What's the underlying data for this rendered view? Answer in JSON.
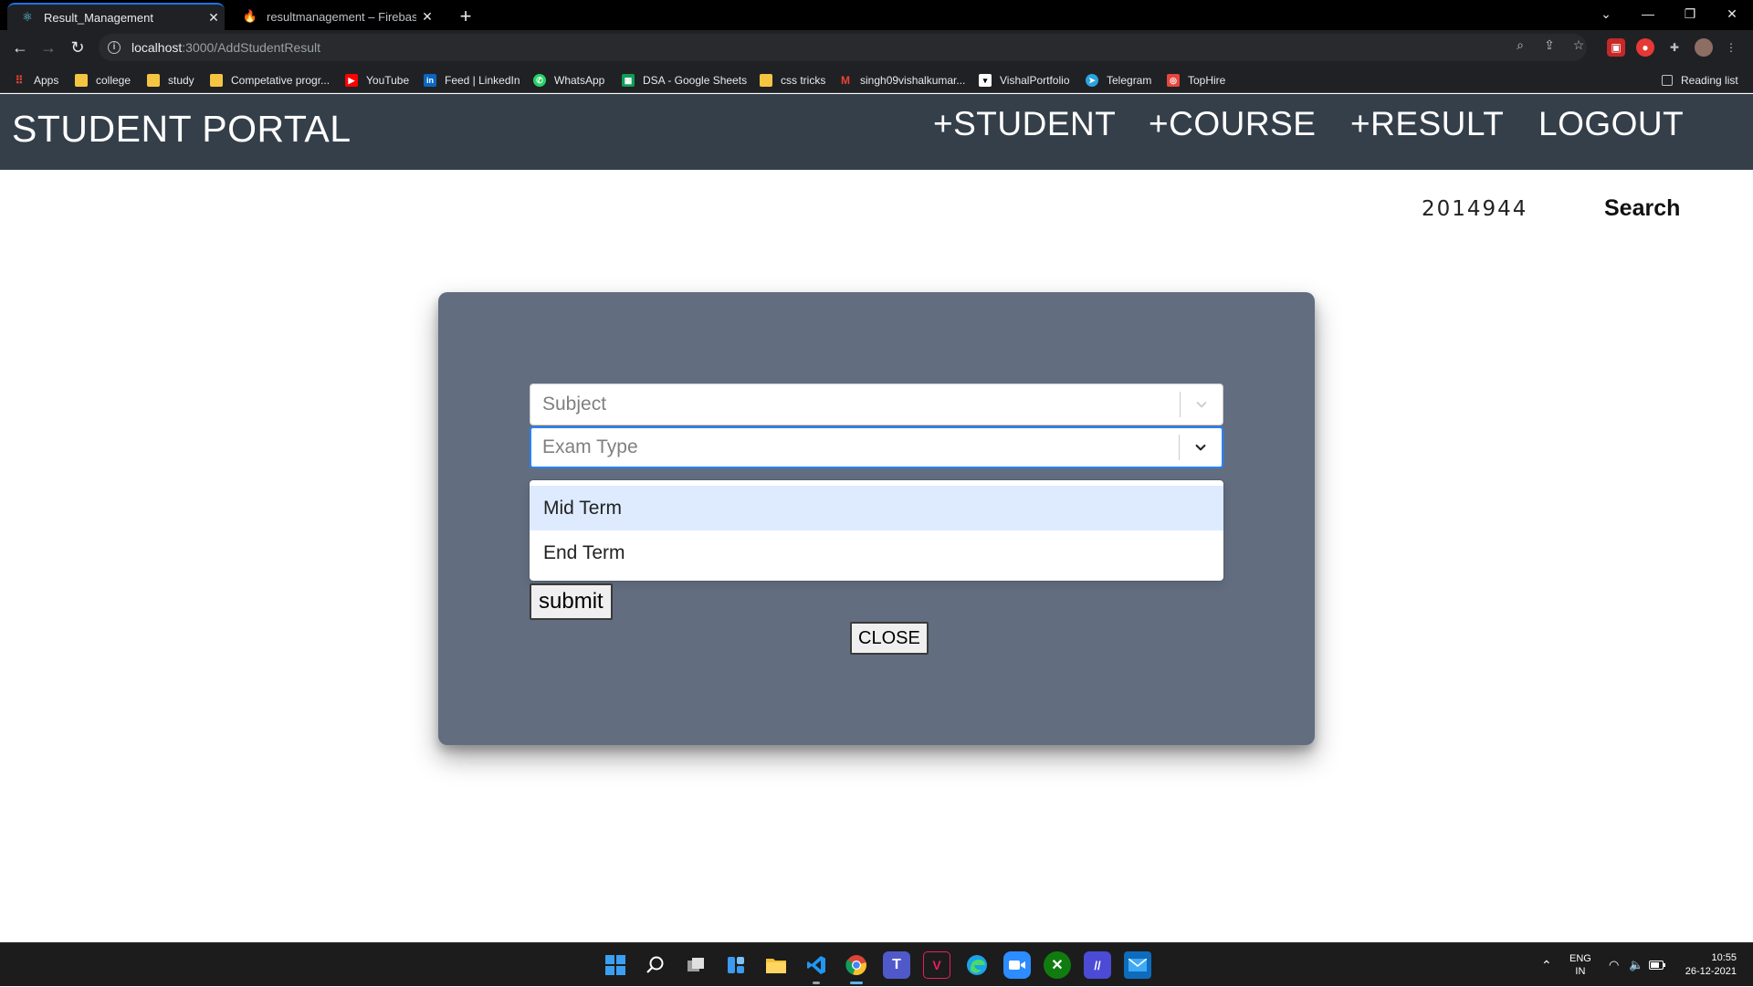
{
  "browser": {
    "tabs": [
      {
        "title": "Result_Management",
        "favicon": "react-icon",
        "active": true
      },
      {
        "title": "resultmanagement – Firebase co",
        "favicon": "firebase-icon",
        "active": false
      }
    ],
    "url_host": "localhost",
    "url_path": ":3000/AddStudentResult",
    "bookmarks": [
      {
        "label": "Apps",
        "icon": "apps-grid-icon",
        "color": "#ea4335"
      },
      {
        "label": "college",
        "icon": "folder-icon",
        "color": "#f4c542"
      },
      {
        "label": "study",
        "icon": "folder-icon",
        "color": "#f4c542"
      },
      {
        "label": "Competative progr...",
        "icon": "folder-icon",
        "color": "#f4c542"
      },
      {
        "label": "YouTube",
        "icon": "youtube-icon",
        "color": "#ff0000"
      },
      {
        "label": "Feed | LinkedIn",
        "icon": "linkedin-icon",
        "color": "#0a66c2"
      },
      {
        "label": "WhatsApp",
        "icon": "whatsapp-icon",
        "color": "#25d366"
      },
      {
        "label": "DSA - Google Sheets",
        "icon": "sheets-icon",
        "color": "#0f9d58"
      },
      {
        "label": "css tricks",
        "icon": "folder-icon",
        "color": "#f4c542"
      },
      {
        "label": "singh09vishalkumar...",
        "icon": "gmail-icon",
        "color": "#ea4335"
      },
      {
        "label": "VishalPortfolio",
        "icon": "portfolio-icon",
        "color": "#ffffff"
      },
      {
        "label": "Telegram",
        "icon": "telegram-icon",
        "color": "#2aa3df"
      },
      {
        "label": "TopHire",
        "icon": "tophire-icon",
        "color": "#e8453c"
      }
    ],
    "reading_list": "Reading list"
  },
  "app": {
    "brand": "STUDENT PORTAL",
    "nav": [
      "+STUDENT",
      "+COURSE",
      "+RESULT",
      "LOGOUT"
    ],
    "roll_number": "2014944",
    "search_label": "Search",
    "accent": "#353f4a",
    "modal_color": "#626d80"
  },
  "form": {
    "subject_placeholder": "Subject",
    "exam_type_placeholder": "Exam Type",
    "exam_options": [
      "Mid Term",
      "End Term"
    ],
    "highlighted_option": "Mid Term",
    "submit_label": "submit",
    "close_label": "CLOSE"
  },
  "taskbar": {
    "language": "ENG",
    "region": "IN",
    "time": "10:55",
    "date": "26-12-2021"
  }
}
